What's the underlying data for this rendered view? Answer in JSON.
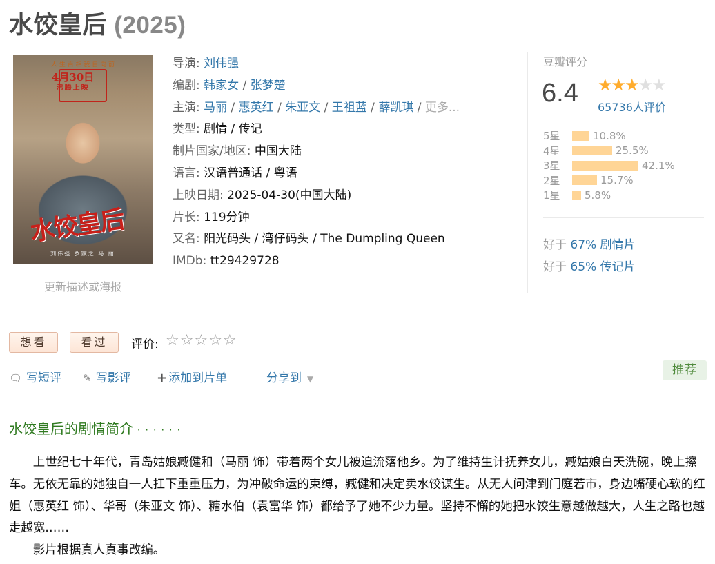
{
  "title": "水饺皇后",
  "year": "(2025)",
  "poster": {
    "top_text": "人 生 百 相    我 自 向 前",
    "date_big": "4月30日",
    "date_small": "沸腾上映",
    "name_art": "水饺皇后",
    "credits": "刘伟强   罗家之   马 丽"
  },
  "update_link": "更新描述或海报",
  "info": {
    "director_label": "导演:",
    "directors": [
      "刘伟强"
    ],
    "writer_label": "编剧:",
    "writers": [
      "韩家女",
      "张梦楚"
    ],
    "cast_label": "主演:",
    "cast": [
      "马丽",
      "惠英红",
      "朱亚文",
      "王祖蓝",
      "薛凯琪"
    ],
    "cast_more": "更多...",
    "genre_label": "类型:",
    "genre": "剧情 / 传记",
    "country_label": "制片国家/地区:",
    "country": "中国大陆",
    "language_label": "语言:",
    "language": "汉语普通话 / 粤语",
    "release_label": "上映日期:",
    "release": "2025-04-30(中国大陆)",
    "runtime_label": "片长:",
    "runtime": "119分钟",
    "aka_label": "又名:",
    "aka": "阳光码头 / 湾仔码头 / The Dumpling Queen",
    "imdb_label": "IMDb:",
    "imdb": "tt29429728"
  },
  "rating": {
    "label": "豆瓣评分",
    "score": "6.4",
    "stars_filled": 3,
    "stars_total": 5,
    "votes": "65736人评价",
    "distribution": [
      {
        "label": "5星",
        "percent": "10.8%",
        "value": 10.8
      },
      {
        "label": "4星",
        "percent": "25.5%",
        "value": 25.5
      },
      {
        "label": "3星",
        "percent": "42.1%",
        "value": 42.1
      },
      {
        "label": "2星",
        "percent": "15.7%",
        "value": 15.7
      },
      {
        "label": "1星",
        "percent": "5.8%",
        "value": 5.8
      }
    ],
    "better_than": [
      {
        "prefix": "好于 ",
        "link": "67% 剧情片"
      },
      {
        "prefix": "好于 ",
        "link": "65% 传记片"
      }
    ]
  },
  "actions": {
    "want": "想看",
    "seen": "看过",
    "rate_label": "评价:",
    "short_review": "写短评",
    "review": "写影评",
    "add_list": "添加到片单",
    "share": "分享到",
    "recommend": "推荐"
  },
  "synopsis": {
    "title": "水饺皇后的剧情简介",
    "dots": " · · · · · ·",
    "para1": "上世纪七十年代，青岛姑娘臧健和（马丽 饰）带着两个女儿被迫流落他乡。为了维持生计抚养女儿，臧姑娘白天洗碗，晚上擦车。无依无靠的她独自一人扛下重重压力，为冲破命运的束缚，臧健和决定卖水饺谋生。从无人问津到门庭若市，身边嘴硬心软的红姐（惠英红 饰）、华哥（朱亚文 饰）、糖水伯（袁富华 饰）都给予了她不少力量。坚持不懈的她把水饺生意越做越大，人生之路也越走越宽……",
    "para2": "影片根据真人真事改编。"
  },
  "colors": {
    "link": "#3377aa",
    "star_on": "#ffac2d",
    "bar": "#ffd596",
    "section_title": "#2f7a20"
  }
}
